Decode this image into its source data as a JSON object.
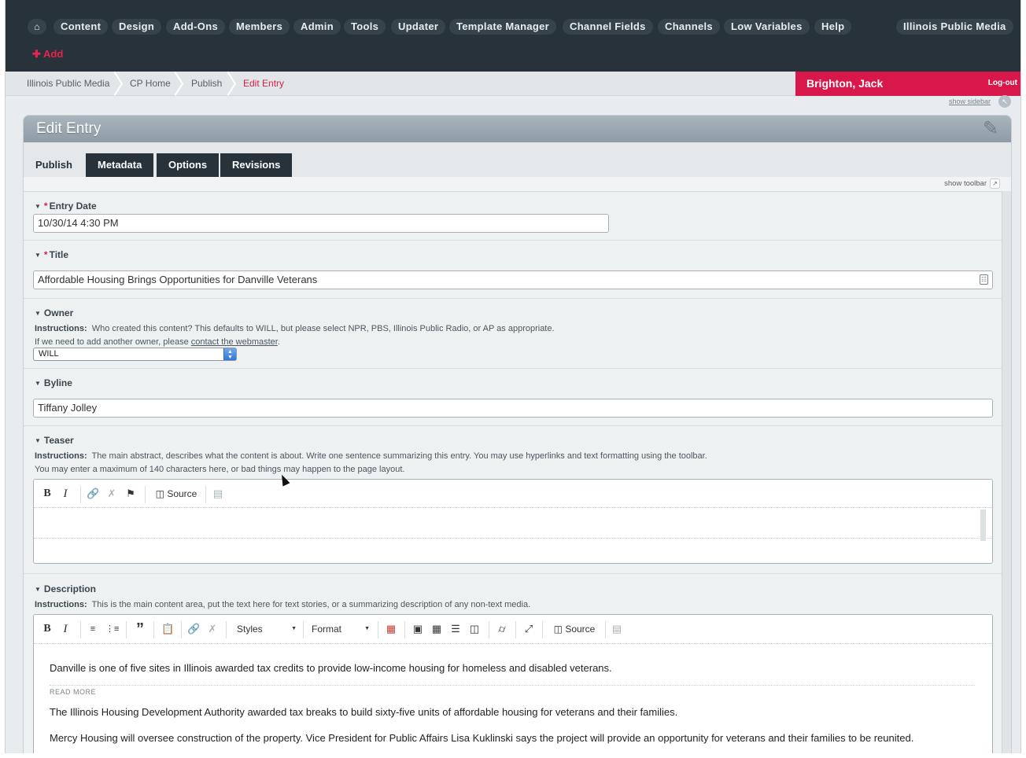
{
  "nav": {
    "items": [
      "Content",
      "Design",
      "Add-Ons",
      "Members",
      "Admin",
      "Tools",
      "Updater",
      "Template Manager",
      "Channel Fields",
      "Channels",
      "Low Variables",
      "Help"
    ],
    "site": "Illinois Public Media",
    "add": "Add",
    "home_icon": "home-icon"
  },
  "breadcrumb": [
    "Illinois Public Media",
    "CP Home",
    "Publish",
    "Edit Entry"
  ],
  "user": {
    "name": "Brighton, Jack",
    "logout": "Log-out",
    "show_sidebar": "show sidebar"
  },
  "panel": {
    "title": "Edit Entry",
    "tabs": [
      "Publish",
      "Metadata",
      "Options",
      "Revisions"
    ],
    "show_toolbar": "show toolbar"
  },
  "fields": {
    "entry_date": {
      "label": "Entry Date",
      "value": "10/30/14 4:30 PM"
    },
    "title": {
      "label": "Title",
      "value": "Affordable Housing Brings Opportunities for Danville Veterans"
    },
    "owner": {
      "label": "Owner",
      "instr_label": "Instructions:",
      "instr_1": "Who created this content?  This defaults to WILL, but please select NPR, PBS, Illinois Public Radio, or AP as appropriate.",
      "instr_2a": "If we need to add another owner, please ",
      "instr_2_link": "contact the webmaster",
      "instr_2b": ".",
      "value": "WILL"
    },
    "byline": {
      "label": "Byline",
      "value": "Tiffany Jolley"
    },
    "teaser": {
      "label": "Teaser",
      "instr_label": "Instructions:",
      "instr_1": "The main abstract, describes what the content is about. Write one sentence summarizing this entry. You may use hyperlinks and text formatting using the toolbar.",
      "instr_2": "You may enter a maximum of 140 characters here, or bad things may happen to the page layout.",
      "source": "Source"
    },
    "description": {
      "label": "Description",
      "instr_label": "Instructions:",
      "instr_1": "This is the main content area, put the text here for text stories, or a summarizing description of any non-text media.",
      "styles": "Styles",
      "format": "Format",
      "source": "Source",
      "para_1": "Danville is one of five sites in Illinois awarded tax credits to provide low-income housing for homeless and disabled veterans.",
      "read_more": "READ MORE",
      "para_2": "The Illinois Housing Development Authority awarded tax breaks to build sixty-five units of affordable housing for veterans and their families.",
      "para_3": "Mercy Housing will oversee construction of the property. Vice President for Public Affairs Lisa Kuklinski says the project will provide an opportunity for veterans and their families to be reunited."
    }
  }
}
